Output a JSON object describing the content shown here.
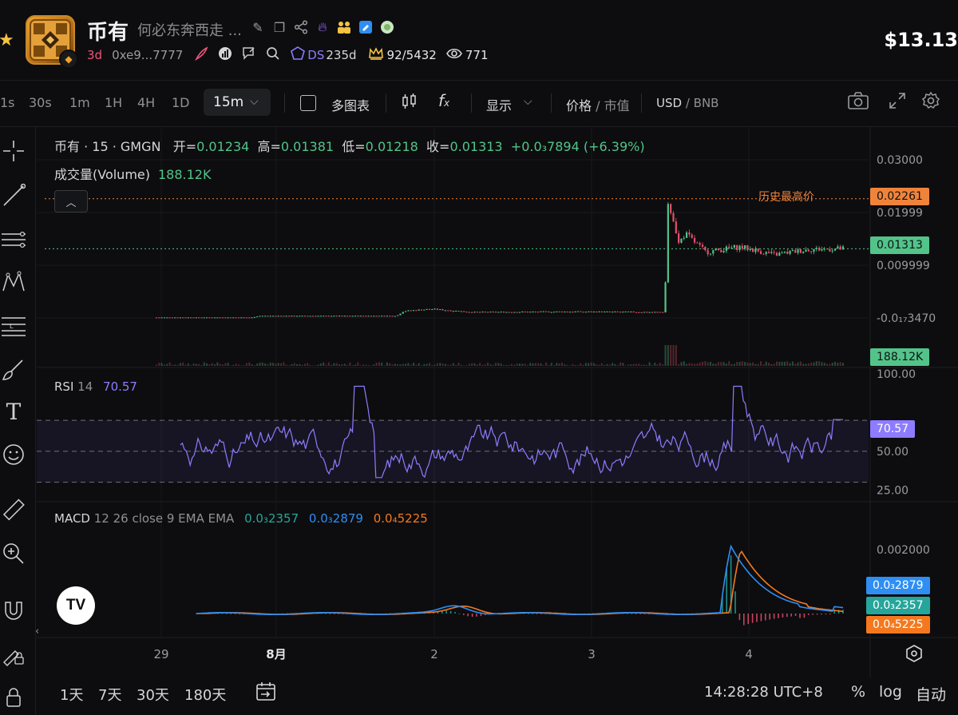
{
  "header": {
    "token_name": "币有",
    "token_desc": "何必东奔西走 ...",
    "age": "3d",
    "address": "0xe9...7777",
    "ds_label": "DS",
    "ds_age": "235d",
    "holders": "92/5432",
    "views": "771",
    "price": "$13.13"
  },
  "toolbar": {
    "timeframes": [
      "1s",
      "30s",
      "1m",
      "1H",
      "4H",
      "1D"
    ],
    "active_timeframe": "15m",
    "multi_chart": "多图表",
    "display": "显示",
    "price_label": "价格",
    "marketcap_label": "市值",
    "currency_primary": "USD",
    "currency_secondary": "BNB"
  },
  "legend": {
    "symbol": "币有 · 15 · GMGN",
    "open_label": "开=",
    "open": "0.01234",
    "high_label": "高=",
    "high": "0.01381",
    "low_label": "低=",
    "low": "0.01218",
    "close_label": "收=",
    "close": "0.01313",
    "change": "+0.0₃7894 (+6.39%)",
    "volume_label": "成交量(Volume)",
    "volume": "188.12K"
  },
  "rsi": {
    "name": "RSI",
    "period": "14",
    "value": "70.57"
  },
  "macd": {
    "name": "MACD",
    "params": "12 26 close 9 EMA EMA",
    "histogram": "0.0₃2357",
    "macd": "0.0₃2879",
    "signal": "0.0₄5225"
  },
  "chart_data": {
    "type": "candlestick",
    "symbol": "币有",
    "interval": "15",
    "source": "GMGN",
    "price_axis_ticks": [
      "0.03000",
      "0.01999",
      "0.009999",
      "-0.0₁₇3470"
    ],
    "price_ylim": [
      0.0,
      0.03
    ],
    "all_time_high": {
      "label": "历史最高价",
      "value": "0.02261"
    },
    "last_price": "0.01313",
    "last_volume": "188.12K",
    "x_ticks": [
      "29",
      "8月",
      "2",
      "3",
      "4"
    ],
    "close_series": [
      {
        "t": 0.0,
        "v": 0.0001
      },
      {
        "t": 0.14,
        "v": 0.0001
      },
      {
        "t": 0.15,
        "v": 0.0004
      },
      {
        "t": 0.35,
        "v": 0.0004
      },
      {
        "t": 0.36,
        "v": 0.0013
      },
      {
        "t": 0.4,
        "v": 0.0017
      },
      {
        "t": 0.46,
        "v": 0.0011
      },
      {
        "t": 0.6,
        "v": 0.0012
      },
      {
        "t": 0.74,
        "v": 0.0011
      },
      {
        "t": 0.745,
        "v": 0.0226
      },
      {
        "t": 0.76,
        "v": 0.014
      },
      {
        "t": 0.77,
        "v": 0.016
      },
      {
        "t": 0.8,
        "v": 0.0125
      },
      {
        "t": 0.85,
        "v": 0.0135
      },
      {
        "t": 0.9,
        "v": 0.012
      },
      {
        "t": 0.95,
        "v": 0.013
      },
      {
        "t": 1.0,
        "v": 0.01313
      }
    ],
    "rsi_ticks": [
      "100.00",
      "50.00",
      "25.00"
    ],
    "rsi_ylim": [
      20,
      100
    ],
    "rsi_bands": [
      30,
      50,
      70
    ],
    "rsi_value": "70.57",
    "macd_ticks": [
      "0.002000"
    ],
    "macd_value": "0.0₃2879",
    "macd_histogram_value": "0.0₃2357",
    "macd_signal_value": "0.0₄5225"
  },
  "bottom": {
    "ranges": [
      "1天",
      "7天",
      "30天",
      "180天"
    ],
    "clock": "14:28:28 UTC+8",
    "percent": "%",
    "log": "log",
    "auto": "自动"
  },
  "colors": {
    "up": "#52c48a",
    "down": "#e5506b",
    "rsi": "#8d7cff",
    "macd": "#2e8ef3",
    "signal": "#f5781e",
    "hist": "#26a69a",
    "ath": "#f0833a"
  }
}
